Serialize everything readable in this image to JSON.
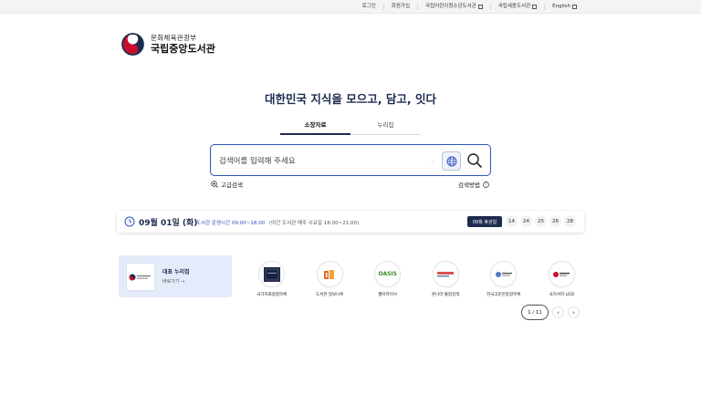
{
  "topbar": {
    "links": [
      {
        "label": "로그인",
        "external": false
      },
      {
        "label": "회원가입",
        "external": false
      },
      {
        "label": "국립어린이청소년도서관",
        "external": true
      },
      {
        "label": "국립세종도서관",
        "external": true
      },
      {
        "label": "English",
        "external": true
      }
    ]
  },
  "logo": {
    "ministry": "문화체육관광부",
    "library": "국립중앙도서관"
  },
  "headline": "대한민국 지식을  모으고, 담고, 잇다",
  "tabs": [
    {
      "label": "소장자료",
      "active": true
    },
    {
      "label": "누리집",
      "active": false
    }
  ],
  "search": {
    "placeholder": "검색어를 입력해 주세요",
    "dot": "·"
  },
  "advanced_search": "고급검색",
  "search_method": "검색방법",
  "help_mark": "?",
  "datebar": {
    "date": "09월 01일 (화)",
    "hours": "도서관 운영시간 09:00~18:00",
    "night": "(야간 도서관 매주 수요일 18:00~21:00)",
    "closed_label": "09월 휴관일",
    "closed_days": [
      "14",
      "24",
      "25",
      "26",
      "28"
    ]
  },
  "featured": {
    "title": "대표 누리집",
    "go": "바로가기 →"
  },
  "sites": [
    {
      "label": "국가자료종합목록",
      "icon": "book-cover-icon"
    },
    {
      "label": "도서관 정보나루",
      "icon": "books-icon"
    },
    {
      "label": "웹아카이브",
      "icon": "oasis-logo",
      "logo_text": "OASIS"
    },
    {
      "label": "온나라 통합검색",
      "icon": "search-logo"
    },
    {
      "label": "한국고문헌종합목록",
      "icon": "archive-logo"
    },
    {
      "label": "국가서지 LOD",
      "icon": "lod-logo"
    }
  ],
  "pager": {
    "count": "1 / 11",
    "prev": "‹",
    "next": "›"
  },
  "colors": {
    "navy": "#1d2b4f",
    "blue": "#2f55b9",
    "card_bg": "#e4ebfa",
    "topbar_bg": "#f3f4f6"
  }
}
